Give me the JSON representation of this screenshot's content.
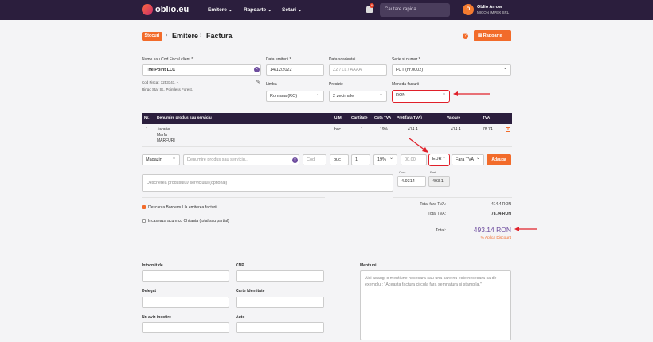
{
  "nav": {
    "logo": "oblio.eu",
    "menu": [
      "Emitere",
      "Rapoarte",
      "Setari"
    ],
    "notification_count": "6",
    "search_placeholder": "Cautare rapida ...",
    "user_initial": "O",
    "user_name": "Oblio Arrow",
    "user_company": "MICON IMPEX SRL"
  },
  "breadcrumb": {
    "stocuri": "Stocuri",
    "emitere": "Emitere",
    "factura": "Factura"
  },
  "rapoarte_button": "Rapoarte",
  "client": {
    "label": "Nume sau Cod Fiscal client *",
    "value": "The Point LLC",
    "cod_fiscal": "Cod Fiscal: 1253141, -,",
    "address": "Ringo Star St., Pointless Forest,"
  },
  "data_emiterii": {
    "label": "Data emiterii *",
    "value": "14/12/2022"
  },
  "data_scadentei": {
    "label": "Data scadentei",
    "placeholder": "ZZ / LL / AAAA"
  },
  "serie": {
    "label": "Serie si numar *",
    "value": "FCT (nr.0002)"
  },
  "limba": {
    "label": "Limba",
    "value": "Romana (RO)"
  },
  "precizie": {
    "label": "Precizie",
    "value": "2 zecimale"
  },
  "moneda": {
    "label": "Moneda facturii",
    "value": "RON"
  },
  "table": {
    "headers": [
      "Nr.",
      "Denumire produs sau serviciu",
      "U.M.",
      "Cantitate",
      "Cota TVA",
      "Pret(fara TVA)",
      "Valoare",
      "TVA"
    ],
    "rows": [
      {
        "nr": "1",
        "name": "Jucarie",
        "desc1": "Marfa",
        "desc2": "MARFURI",
        "um": "buc",
        "qty": "1",
        "cota": "19%",
        "pret": "414.4",
        "valoare": "414.4",
        "tva": "78.74"
      }
    ]
  },
  "add_row": {
    "gestiune": "Magazin",
    "product_placeholder": "Denumire produs sau serviciu...",
    "cod_placeholder": "Cod",
    "um": "buc",
    "qty": "1",
    "cota": "19%",
    "pret_placeholder": "00.00",
    "moneda": "EUR",
    "tva_mode": "Fara TVA",
    "add_button": "Adauga",
    "desc_placeholder": "Descrierea produsului/ serviciului (optional)",
    "curs_label": "Curs",
    "curs_value": "4.9314",
    "pret_label": "Pret",
    "pret_value": "493.1:"
  },
  "options": {
    "descarca": "Descarca Borderoul la emiterea facturii",
    "incaseaza": "Incaseaza acum cu Chitanta (total sau partial)"
  },
  "totals": {
    "total_fara_tva_label": "Total fara TVA:",
    "total_fara_tva_value": "414.4 RON",
    "total_tva_label": "Total TVA:",
    "total_tva_value": "78.74 RON",
    "total_label": "Total:",
    "total_value": "493.14 RON",
    "discount": "% Aplica Discount"
  },
  "bottom": {
    "intocmit": "Intocmit de",
    "cnp": "CNP",
    "delegat": "Delegat",
    "carte": "Carte Identitate",
    "aviz": "Nr. aviz insotire",
    "auto": "Auto",
    "mentiuni": "Mentiuni",
    "mentiuni_placeholder": "Aici adaugi o mentiune necesara sau una care nu este necesara ca de exemplu : \"Aceasta factura circula fara semnatura si stampila.\""
  },
  "colors": {
    "nav": "#2b1e3d",
    "accent": "#f26b2a",
    "highlight": "#e0202a",
    "total": "#6d4c9e"
  }
}
